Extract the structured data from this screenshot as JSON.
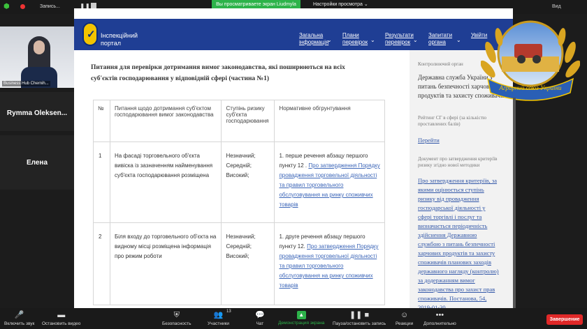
{
  "topbar": {
    "rec_label": "Запись...",
    "share_banner": "Вы просматриваете экран Liudmyla",
    "view_settings": "Настройки просмотра ⌄",
    "view_label": "Вид"
  },
  "participants": [
    {
      "name": "Business Hub Chernih..."
    },
    {
      "name": "Rymma  Oleksen..."
    },
    {
      "name": "Елена"
    }
  ],
  "site": {
    "portal_name": "Інспекційний портал",
    "nav": [
      "Загальна інформація",
      "Плани перевірок",
      "Результати перевірок",
      "Запитати органа",
      "Увійти"
    ],
    "heading": "Питання для перевірки дотримання вимог законодавства, які поширюються на всіх суб'єктів господарювання у відповідній сфері (частина №1)",
    "table": {
      "headers": [
        "№",
        "Питання щодо дотримання суб'єктом господарювання вимог законодавства",
        "Ступінь ризику суб'єкта господарювання",
        "Нормативне обгрунтування"
      ],
      "rows": [
        {
          "num": "1",
          "question": "На фасаді торговельного об'єкта вивіска із зазначенням найменування суб'єкта господарювання розміщена",
          "risk": "Незначний; Середній; Високий;",
          "norm_prefix": "1. перше речення абзацу першого пункту 12 .",
          "norm_link": "Про затвердження Порядку провадження торговельної діяльності та правил торговельного обслуговування на ринку споживчих товарів"
        },
        {
          "num": "2",
          "question": "Біля входу до торговельного об'єкта на видному місці розміщена інформація про режим роботи",
          "risk": "Незначний; Середній; Високий;",
          "norm_prefix": "1. друге речення абзацу першого пункту 12.",
          "norm_link": "Про затвердження Порядку провадження торговельної діяльності та правил торговельного обслуговування на ринку споживчих товарів"
        }
      ]
    },
    "sidebar": {
      "label1": "Контролюючий орган",
      "text1": "Державна служба України з питань безпечності харчових продуктів та захисту споживачів",
      "label2": "Рейтинг СГ в сфері (за кількістю проставлених балів)",
      "link1": "Перейти",
      "label3": "Документ про затвердження критеріїв ризику згідно нової методики",
      "link2": "Про затвердження критеріїв, за якими оцінюється ступінь ризику від провадження господарської діяльності у сфері торгівлі і послуг та визначається періодичність здійснення Державною службою з питань безпечності харчових продуктів та захисту споживачів планових заходів державного нагляду (контролю) за додержанням вимог законодавства про захист прав споживачів. Постанова, 54, 2019-01-30"
    },
    "emblem_text": "Аграрний союз України"
  },
  "bottombar": {
    "items": [
      "Включить звук",
      "Остановить видео",
      "Безопасность",
      "Участники",
      "Чат",
      "Демонстрация экрана",
      "Пауза/остановить запись",
      "Реакции",
      "Дополнительно"
    ],
    "participants_count": "13",
    "end": "Завершение"
  }
}
